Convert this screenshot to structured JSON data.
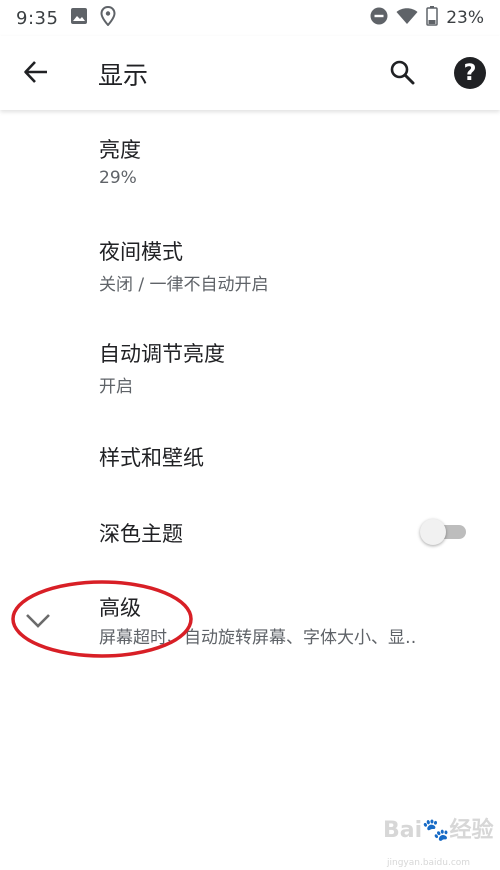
{
  "status": {
    "time": "9:35",
    "battery": "23%"
  },
  "header": {
    "title": "显示"
  },
  "settings": [
    {
      "title": "亮度",
      "subtitle": "29%"
    },
    {
      "title": "夜间模式",
      "subtitle": "关闭 / 一律不自动开启"
    },
    {
      "title": "自动调节亮度",
      "subtitle": "开启"
    },
    {
      "title": "样式和壁纸"
    },
    {
      "title": "深色主题",
      "toggle_on": false
    },
    {
      "title": "高级",
      "subtitle": "屏幕超时、自动旋转屏幕、字体大小、显‥"
    }
  ],
  "watermark": {
    "text": "Bai🐾经验",
    "url": "jingyan.baidu.com"
  },
  "colors": {
    "annotation": "#d81f26",
    "toggle_track": "#bdbdbd"
  },
  "icons": [
    "image-icon",
    "location-icon",
    "dnd-icon",
    "wifi-icon",
    "battery-icon",
    "back-arrow-icon",
    "search-icon",
    "help-icon",
    "chevron-down-icon"
  ]
}
